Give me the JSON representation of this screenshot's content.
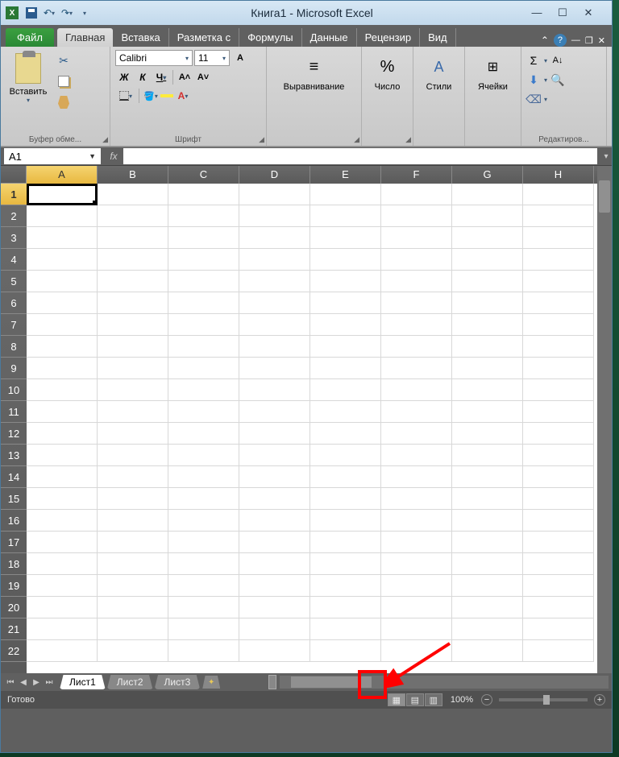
{
  "title": "Книга1 - Microsoft Excel",
  "tabs": {
    "file": "Файл",
    "home": "Главная",
    "insert": "Вставка",
    "layout": "Разметка с",
    "formulas": "Формулы",
    "data": "Данные",
    "review": "Рецензир",
    "view": "Вид"
  },
  "ribbon": {
    "clipboard": {
      "paste": "Вставить",
      "label": "Буфер обме..."
    },
    "font": {
      "name": "Calibri",
      "size": "11",
      "bold": "Ж",
      "italic": "К",
      "underline": "Ч",
      "label": "Шрифт"
    },
    "alignment": {
      "label": "Выравнивание"
    },
    "number": {
      "label": "Число",
      "symbol": "%"
    },
    "styles": {
      "label": "Стили"
    },
    "cells": {
      "label": "Ячейки"
    },
    "editing": {
      "label": "Редактиров...",
      "sigma": "Σ"
    }
  },
  "namebox": "A1",
  "fx": "fx",
  "columns": [
    "A",
    "B",
    "C",
    "D",
    "E",
    "F",
    "G",
    "H"
  ],
  "rows": [
    "1",
    "2",
    "3",
    "4",
    "5",
    "6",
    "7",
    "8",
    "9",
    "10",
    "11",
    "12",
    "13",
    "14",
    "15",
    "16",
    "17",
    "18",
    "19",
    "20",
    "21",
    "22"
  ],
  "sheets": {
    "s1": "Лист1",
    "s2": "Лист2",
    "s3": "Лист3"
  },
  "status": "Готово",
  "zoom": "100%"
}
